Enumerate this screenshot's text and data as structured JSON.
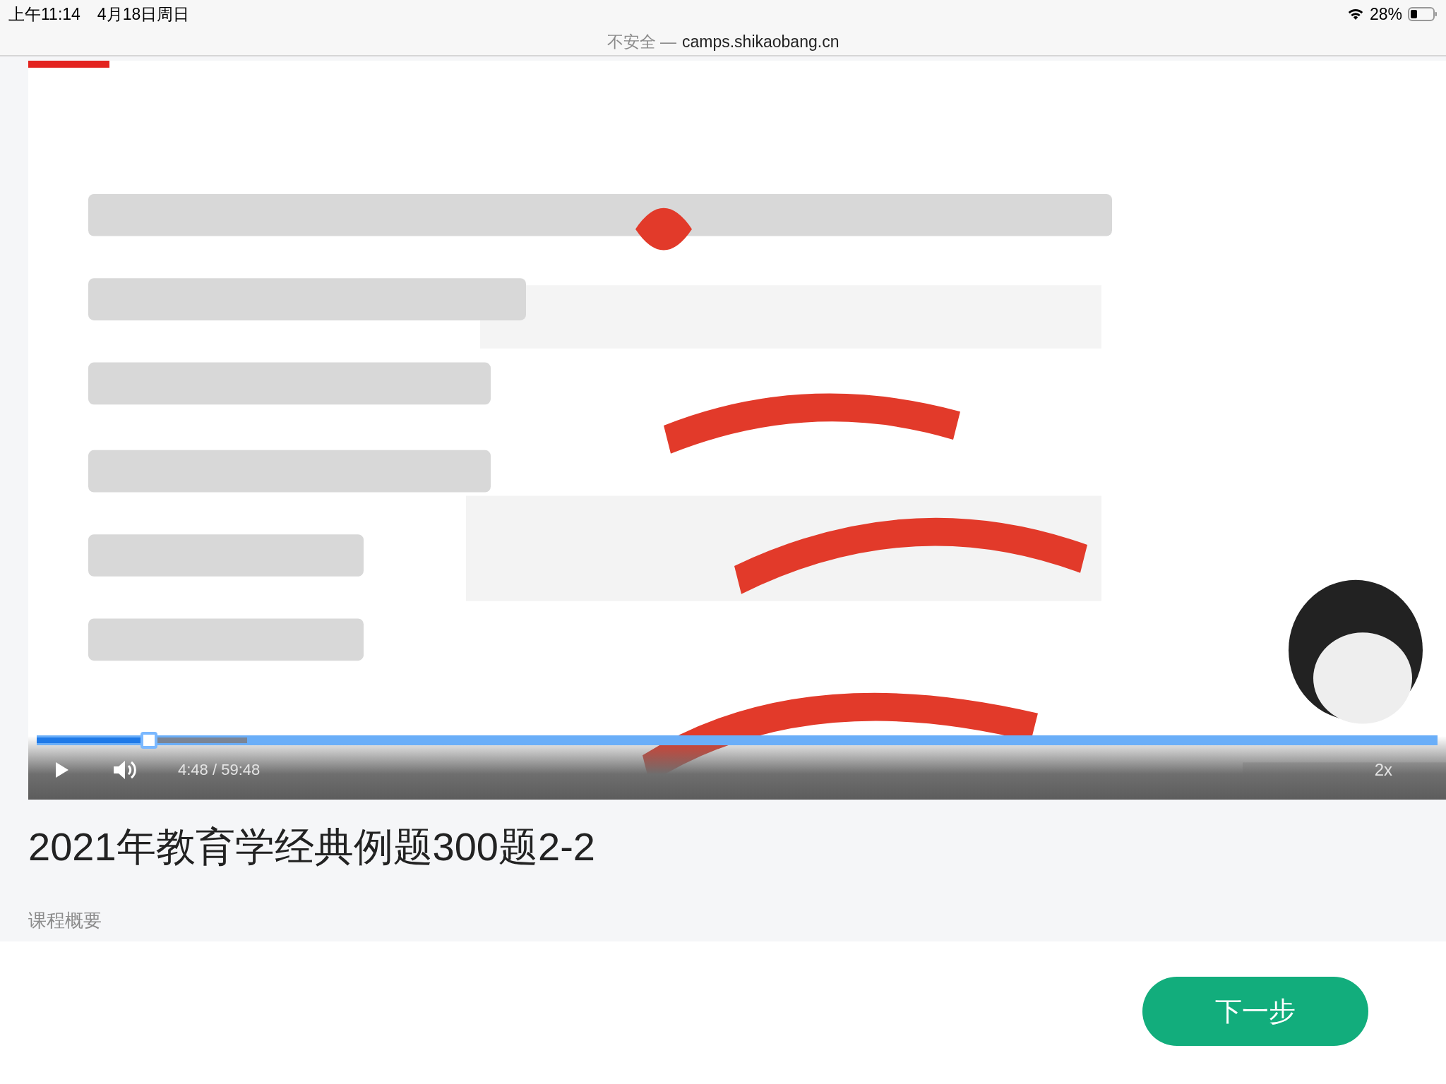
{
  "status_bar": {
    "time": "上午11:14",
    "date": "4月18日周日",
    "battery": "28%"
  },
  "address_bar": {
    "security": "不安全 —",
    "url": "camps.shikaobang.cn"
  },
  "video": {
    "kind": "picture",
    "controls": {
      "playing": false,
      "time": "4:48 / 59:48",
      "speed": "2x",
      "progress": {
        "level": 0.08,
        "buffered": {
          "level": 0.15
        }
      }
    }
  },
  "title": "2021年教育学经典例题300题2-2",
  "section_label": "课程概要",
  "next_button": "下一步"
}
